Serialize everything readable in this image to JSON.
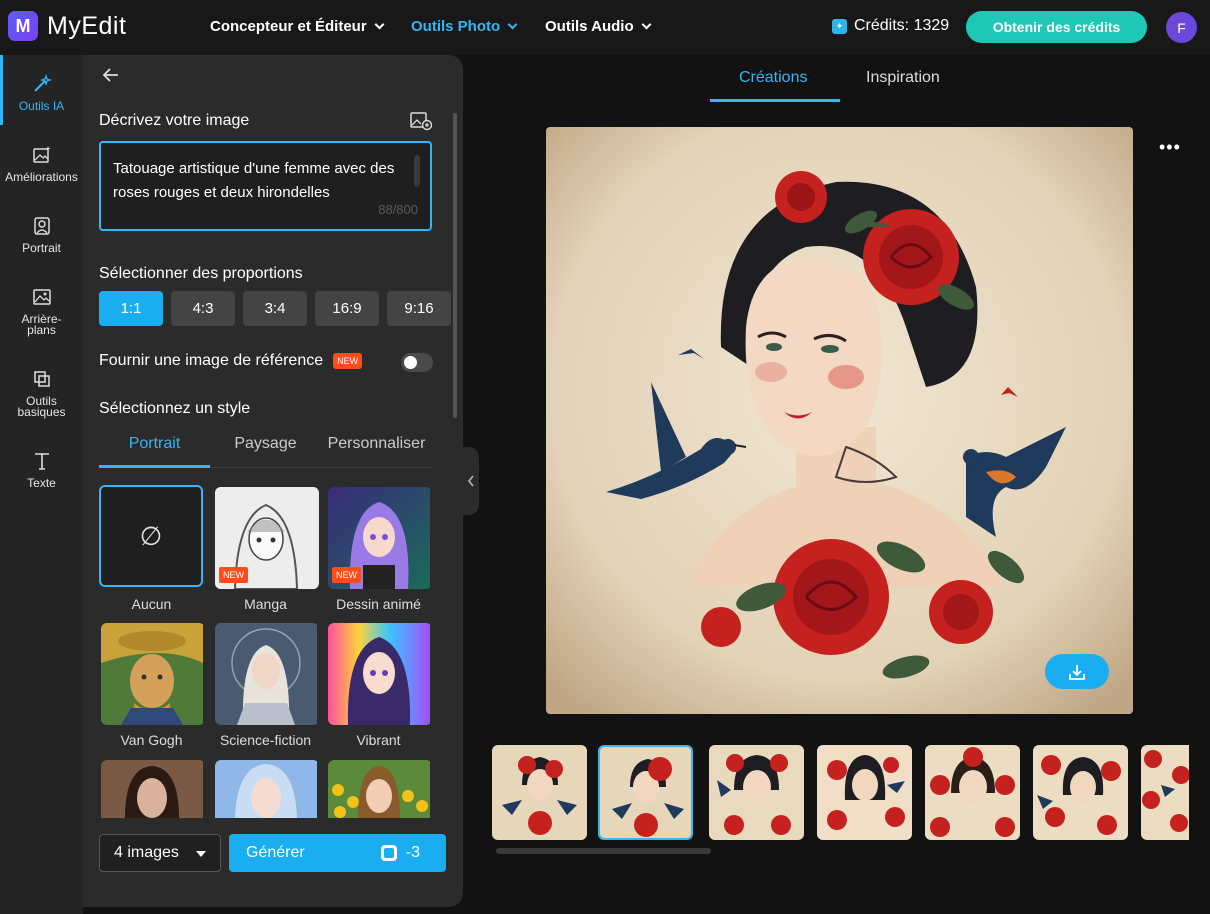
{
  "app": {
    "name": "MyEdit",
    "logo_letter": "M"
  },
  "nav": {
    "items": [
      {
        "label": "Concepteur et Éditeur",
        "active": false
      },
      {
        "label": "Outils Photo",
        "active": true
      },
      {
        "label": "Outils Audio",
        "active": false
      }
    ],
    "credits_label": "Crédits: 1329",
    "get_credits_button": "Obtenir des crédits",
    "avatar_letter": "F"
  },
  "sidebar": {
    "items": [
      {
        "label": "Outils IA",
        "icon": "magic-wand-icon",
        "active": true
      },
      {
        "label": "Améliorations",
        "icon": "image-sparkle-icon",
        "active": false
      },
      {
        "label": "Portrait",
        "icon": "portrait-icon",
        "active": false
      },
      {
        "label": "Arrière-plans",
        "icon": "background-icon",
        "active": false
      },
      {
        "label": "Outils basiques",
        "icon": "crop-icon",
        "active": false
      },
      {
        "label": "Texte",
        "icon": "text-icon",
        "active": false
      }
    ]
  },
  "panel": {
    "describe_label": "Décrivez votre image",
    "prompt_text": "Tatouage artistique d'une femme avec des roses rouges et deux hirondelles",
    "prompt_count": "88/800",
    "proportions_label": "Sélectionner des proportions",
    "ratios": [
      "1:1",
      "4:3",
      "3:4",
      "16:9",
      "9:16"
    ],
    "selected_ratio": "1:1",
    "reference_label": "Fournir une image de référence",
    "new_badge": "NEW",
    "style_label": "Sélectionnez un style",
    "style_tabs": [
      "Portrait",
      "Paysage",
      "Personnaliser"
    ],
    "active_style_tab": "Portrait",
    "styles": [
      {
        "label": "Aucun",
        "symbol": "∅",
        "new": false,
        "selected": true
      },
      {
        "label": "Manga",
        "new": true
      },
      {
        "label": "Dessin animé",
        "new": true
      },
      {
        "label": "Van Gogh",
        "new": false
      },
      {
        "label": "Science-fiction",
        "new": false
      },
      {
        "label": "Vibrant",
        "new": false
      }
    ],
    "image_count": "4 images",
    "generate_button": "Générer",
    "generate_cost": "-3"
  },
  "main": {
    "tabs": [
      "Créations",
      "Inspiration"
    ],
    "active_tab": "Créations",
    "more_label": "•••"
  },
  "colors": {
    "accent": "#34b6f5",
    "primary_button": "#1aaef0",
    "credits_button": "#1fc7b6",
    "new_badge": "#ff4d1a",
    "avatar": "#6b47dc"
  }
}
